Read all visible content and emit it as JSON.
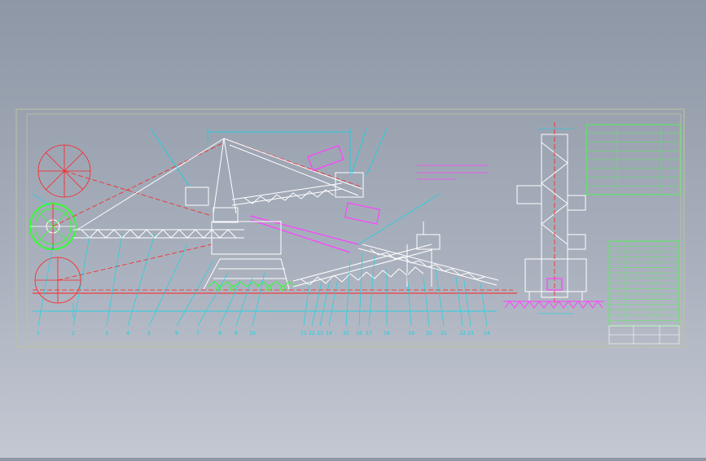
{
  "drawing": {
    "colors": {
      "frame": "#b9c6a0",
      "machine": "#ffffff",
      "dim": "#00d8e8",
      "center": "#ff2020",
      "magenta": "#ff40ff",
      "green": "#30ff30",
      "table_green": "#40ff40",
      "background": "#9aa1ae"
    },
    "part_numbers": [
      "1",
      "2",
      "3",
      "4",
      "5",
      "6",
      "7",
      "8",
      "9",
      "10",
      "11",
      "12",
      "13",
      "14",
      "15",
      "16",
      "17",
      "18",
      "19",
      "20",
      "21",
      "22",
      "23",
      "24"
    ],
    "spec_table_rows": 8,
    "parts_table_rows": 16
  }
}
